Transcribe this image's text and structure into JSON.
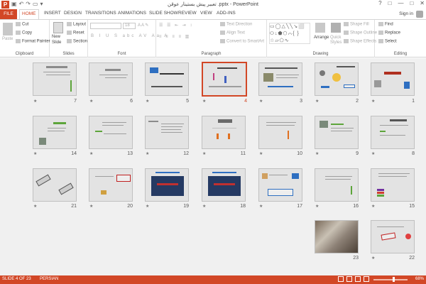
{
  "window": {
    "title": "تعبیر پیش بستینار عوقن .pptx - PowerPoint",
    "controls": [
      "?",
      "□",
      "—",
      "□",
      "✕"
    ]
  },
  "tabs": {
    "file": "FILE",
    "home": "HOME",
    "insert": "INSERT",
    "design": "DESIGN",
    "transitions": "TRANSITIONS",
    "animations": "ANIMATIONS",
    "slideshow": "SLIDE SHOW",
    "review": "REVIEW",
    "view": "VIEW",
    "addins": "ADD-INS",
    "signin": "Sign in"
  },
  "ribbon": {
    "clipboard": {
      "label": "Clipboard",
      "paste": "Paste",
      "cut": "Cut",
      "copy": "Copy",
      "format_painter": "Format Painter"
    },
    "slides": {
      "label": "Slides",
      "new_slide": "New",
      "new_slide2": "Slide",
      "layout": "Layout",
      "reset": "Reset",
      "section": "Section"
    },
    "font": {
      "label": "Font",
      "size": "18"
    },
    "paragraph": {
      "label": "Paragraph",
      "text_direction": "Text Direction",
      "align_text": "Align Text",
      "convert": "Convert to SmartArt"
    },
    "drawing": {
      "label": "Drawing",
      "arrange": "Arrange",
      "quick_styles": "Quick",
      "quick_styles2": "Styles",
      "shape_fill": "Shape Fill",
      "shape_outline": "Shape Outline",
      "shape_effects": "Shape Effects"
    },
    "editing": {
      "label": "Editing",
      "find": "Find",
      "replace": "Replace",
      "select": "Select"
    }
  },
  "slides": [
    {
      "num": "1"
    },
    {
      "num": "2"
    },
    {
      "num": "3"
    },
    {
      "num": "4"
    },
    {
      "num": "5"
    },
    {
      "num": "6"
    },
    {
      "num": "7"
    },
    {
      "num": "8"
    },
    {
      "num": "9"
    },
    {
      "num": "10"
    },
    {
      "num": "11"
    },
    {
      "num": "12"
    },
    {
      "num": "13"
    },
    {
      "num": "14"
    },
    {
      "num": "15"
    },
    {
      "num": "16"
    },
    {
      "num": "17"
    },
    {
      "num": "18"
    },
    {
      "num": "19"
    },
    {
      "num": "20"
    },
    {
      "num": "21"
    },
    {
      "num": "22"
    },
    {
      "num": "23"
    }
  ],
  "star": "★",
  "status": {
    "slide_info": "SLIDE 4 OF 23",
    "language": "PERSIAN",
    "zoom": "68%"
  }
}
